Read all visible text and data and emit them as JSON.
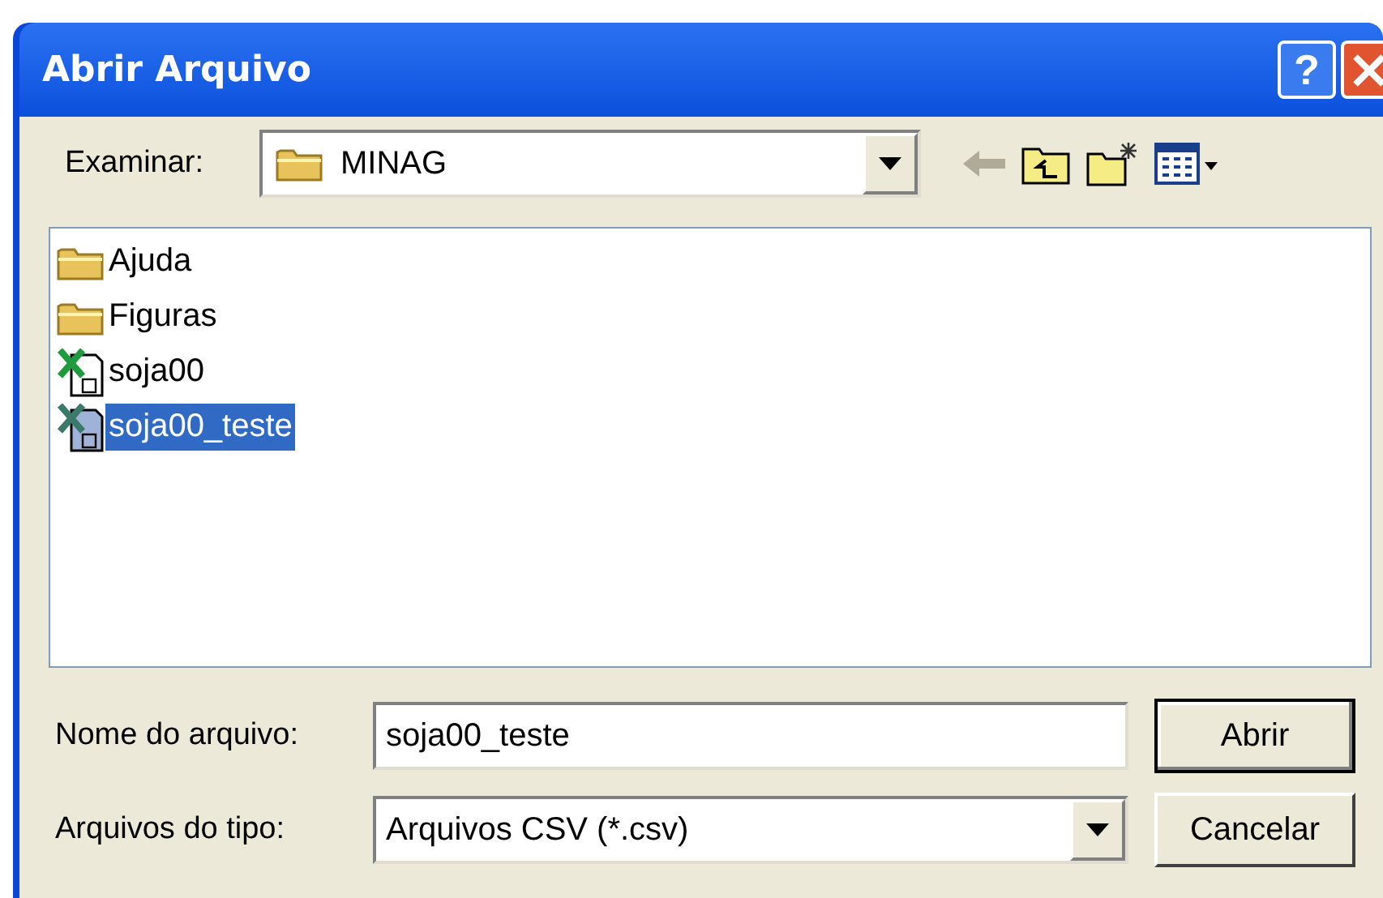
{
  "window": {
    "title": "Abrir Arquivo",
    "help_button": "?"
  },
  "look_in": {
    "label": "Examinar:",
    "value": "MINAG"
  },
  "files": [
    {
      "name": "Ajuda",
      "kind": "folder",
      "selected": false
    },
    {
      "name": "Figuras",
      "kind": "folder",
      "selected": false
    },
    {
      "name": "soja00",
      "kind": "csv",
      "selected": false
    },
    {
      "name": "soja00_teste",
      "kind": "csv",
      "selected": true
    }
  ],
  "file_name": {
    "label": "Nome do arquivo:",
    "value": "soja00_teste"
  },
  "file_type": {
    "label": "Arquivos do tipo:",
    "value": "Arquivos CSV (*.csv)"
  },
  "buttons": [
    "Abrir",
    "Cancelar"
  ]
}
